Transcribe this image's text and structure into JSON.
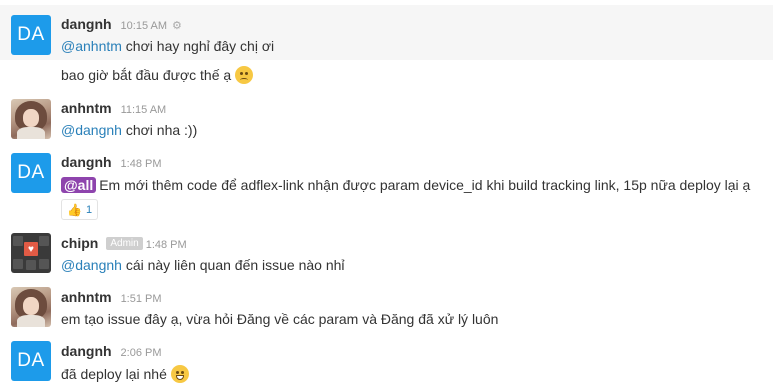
{
  "messages": [
    {
      "author": "dangnh",
      "avatar_text": "DA",
      "time": "10:15 AM",
      "mention": "@anhntm",
      "text": " chơi hay nghỉ đây chị ơi"
    },
    {
      "text": "bao giờ bắt đầu được thế ạ",
      "emoji": "disappointed-face"
    },
    {
      "author": "anhntm",
      "time": "11:15 AM",
      "mention": "@dangnh",
      "text": " chơi nha :))"
    },
    {
      "author": "dangnh",
      "avatar_text": "DA",
      "time": "1:48 PM",
      "mention": "@all",
      "text": "Em mới thêm code để adflex-link nhận được param device_id khi build tracking link, 15p nữa deploy lại ạ",
      "reaction": {
        "emoji": "thumbs-up",
        "count": "1"
      }
    },
    {
      "author": "chipn",
      "badge": "Admin",
      "time": "1:48 PM",
      "mention": "@dangnh",
      "text": " cái này liên quan đến issue nào nhỉ"
    },
    {
      "author": "anhntm",
      "time": "1:51 PM",
      "text": "em tạo issue đây ạ, vừa hỏi Đăng về các param và Đăng đã xử lý luôn"
    },
    {
      "author": "dangnh",
      "avatar_text": "DA",
      "time": "2:06 PM",
      "text": "đã deploy lại nhé",
      "emoji": "grinning-face"
    }
  ],
  "colors": {
    "avatar_blue": "#1d9bea",
    "mention": "#2a80b9",
    "mention_all_bg": "#8e44ad",
    "highlight_row": "#f6f6f6"
  }
}
